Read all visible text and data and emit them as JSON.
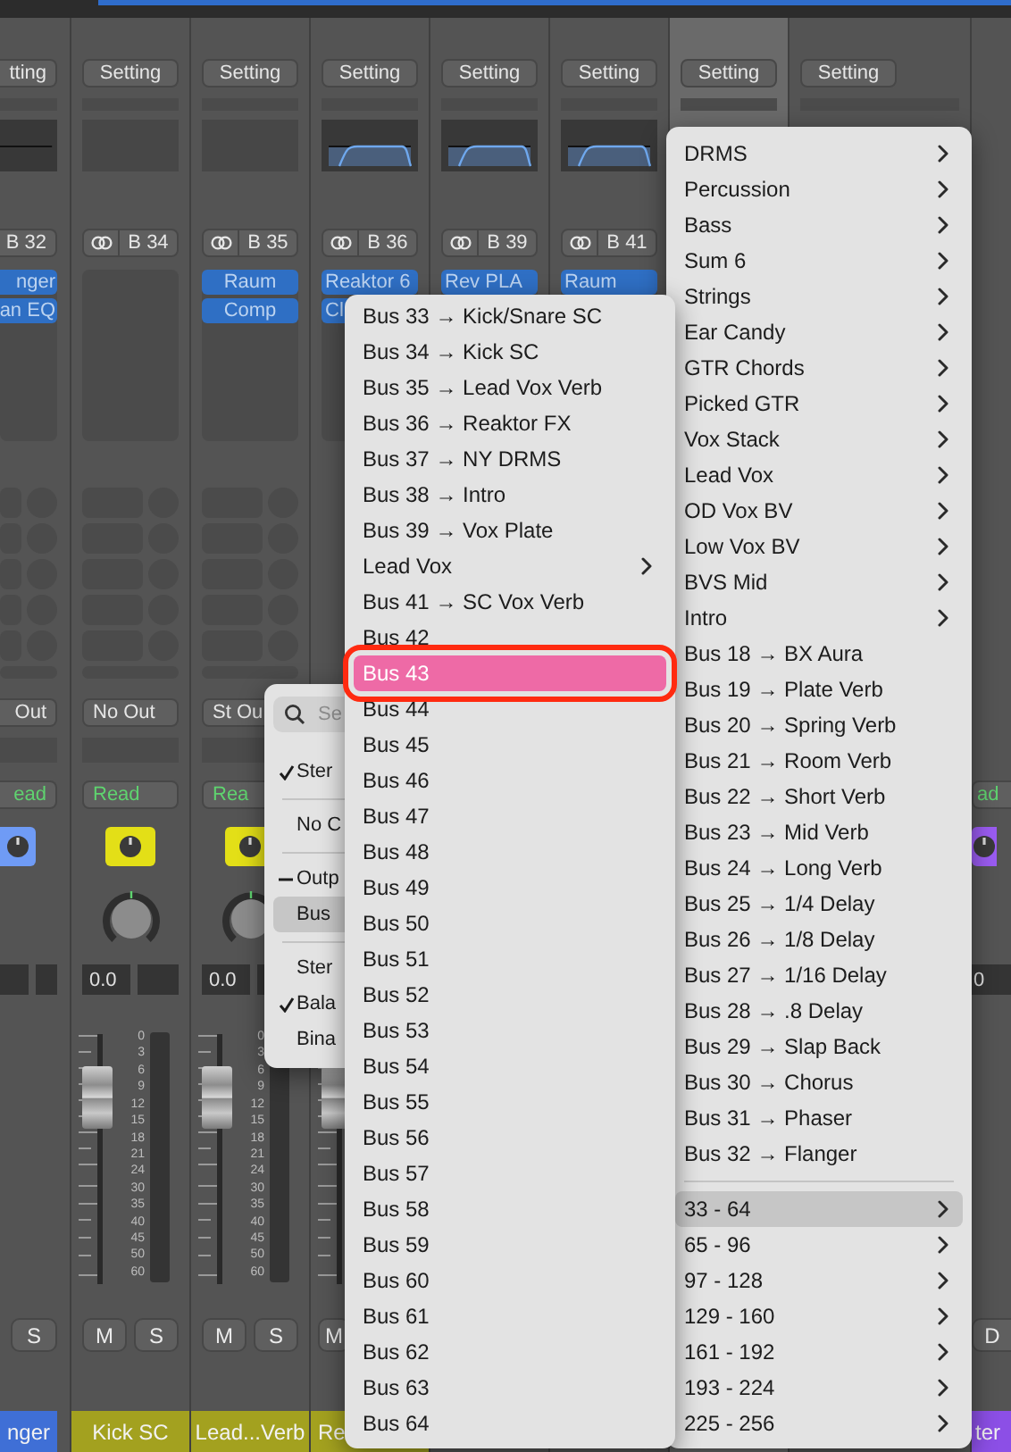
{
  "strips": [
    {
      "setting": "tting",
      "eq": {
        "kind": "flat"
      },
      "input": "B 32",
      "inserts": [
        "nger",
        "an EQ"
      ],
      "output": "Out",
      "automation": "ead",
      "group": {
        "color": "#6f9bf5"
      },
      "buttons": [
        "S"
      ],
      "name": {
        "text": "nger",
        "color": "#3f6fd6"
      },
      "selected": false
    },
    {
      "setting": "Setting",
      "eq": {
        "kind": "empty"
      },
      "input": "B 34",
      "output": "No Out",
      "automation": "Read",
      "group": {
        "color": "#e3df17"
      },
      "pan": "0.0",
      "level": 0.8,
      "scale": [
        "0",
        "3",
        "6",
        "9",
        "12",
        "15",
        "18",
        "21",
        "24",
        "30",
        "35",
        "40",
        "45",
        "50",
        "60"
      ],
      "buttons": [
        "M",
        "S"
      ],
      "name": {
        "text": "Kick SC",
        "color": "#a3a11f"
      },
      "selected": false
    },
    {
      "setting": "Setting",
      "eq": {
        "kind": "empty"
      },
      "input": "B 35",
      "inserts": [
        "Raum",
        "Comp"
      ],
      "output": "St Ou",
      "automation": "Rea",
      "group": {
        "color": "#e3df17"
      },
      "pan": "0.0",
      "level": 0.8,
      "scale": [
        "0",
        "3",
        "6",
        "9",
        "12",
        "15",
        "18",
        "21",
        "24",
        "30",
        "35",
        "40",
        "45",
        "50",
        "60"
      ],
      "buttons": [
        "M",
        "S"
      ],
      "name": {
        "text": "Lead...Verb",
        "color": "#a3a11f"
      },
      "selected": false
    },
    {
      "setting": "Setting",
      "eq": {
        "kind": "curve"
      },
      "input": "B 36",
      "inserts": [
        "Reaktor 6",
        "Cl"
      ],
      "level": 0.8,
      "buttons": [
        "M"
      ],
      "name": {
        "text": "Re",
        "color": "#a3a11f"
      },
      "selected": false
    },
    {
      "setting": "Setting",
      "eq": {
        "kind": "curve"
      },
      "input": "B 39",
      "inserts": [
        "Rev PLA"
      ],
      "selected": false
    },
    {
      "setting": "Setting",
      "eq": {
        "kind": "curve"
      },
      "input": "B 41",
      "inserts": [
        "Raum"
      ],
      "selected": false
    },
    {
      "setting": "Setting",
      "selected": true
    },
    {
      "setting": "Setting",
      "selected": false
    },
    {
      "automation": "ad",
      "group": {
        "color": "#9b5cf2"
      },
      "pan": "0",
      "buttons": [
        "D"
      ],
      "name": {
        "text": "ter",
        "color": "#8c4fe6"
      },
      "selected": false
    }
  ],
  "output_menu": {
    "search": {
      "placeholder": "Se"
    },
    "items": [
      {
        "kind": "item",
        "label": "Ster",
        "checked": true,
        "mixed": false,
        "selected": false
      },
      {
        "kind": "separator"
      },
      {
        "kind": "item",
        "label": "No C",
        "checked": false,
        "mixed": false,
        "selected": false
      },
      {
        "kind": "separator"
      },
      {
        "kind": "item",
        "label": "Outp",
        "checked": false,
        "mixed": true,
        "selected": false
      },
      {
        "kind": "item",
        "label": "Bus",
        "checked": false,
        "mixed": false,
        "selected": true
      },
      {
        "kind": "separator"
      },
      {
        "kind": "item",
        "label": "Ster",
        "checked": false,
        "mixed": false,
        "selected": false
      },
      {
        "kind": "item",
        "label": "Bala",
        "checked": true,
        "mixed": false,
        "selected": false
      },
      {
        "kind": "item",
        "label": "Bina",
        "checked": false,
        "mixed": false,
        "selected": false
      }
    ]
  },
  "bus_menu": {
    "items": [
      {
        "label": "Bus 33 → Kick/Snare SC",
        "submenu": false,
        "selected": false
      },
      {
        "label": "Bus 34 → Kick SC",
        "submenu": false,
        "selected": false
      },
      {
        "label": "Bus 35 → Lead Vox Verb",
        "submenu": false,
        "selected": false
      },
      {
        "label": "Bus 36 → Reaktor FX",
        "submenu": false,
        "selected": false
      },
      {
        "label": "Bus 37 → NY DRMS",
        "submenu": false,
        "selected": false
      },
      {
        "label": "Bus 38 → Intro",
        "submenu": false,
        "selected": false
      },
      {
        "label": "Bus 39 → Vox Plate",
        "submenu": false,
        "selected": false
      },
      {
        "label": "Lead Vox",
        "submenu": true,
        "selected": false
      },
      {
        "label": "Bus 41 → SC Vox Verb",
        "submenu": false,
        "selected": false
      },
      {
        "label": "Bus 42",
        "submenu": false,
        "selected": false
      },
      {
        "label": "Bus 43",
        "submenu": false,
        "selected": true
      },
      {
        "label": "Bus 44",
        "submenu": false,
        "selected": false
      },
      {
        "label": "Bus 45",
        "submenu": false,
        "selected": false
      },
      {
        "label": "Bus 46",
        "submenu": false,
        "selected": false
      },
      {
        "label": "Bus 47",
        "submenu": false,
        "selected": false
      },
      {
        "label": "Bus 48",
        "submenu": false,
        "selected": false
      },
      {
        "label": "Bus 49",
        "submenu": false,
        "selected": false
      },
      {
        "label": "Bus 50",
        "submenu": false,
        "selected": false
      },
      {
        "label": "Bus 51",
        "submenu": false,
        "selected": false
      },
      {
        "label": "Bus 52",
        "submenu": false,
        "selected": false
      },
      {
        "label": "Bus 53",
        "submenu": false,
        "selected": false
      },
      {
        "label": "Bus 54",
        "submenu": false,
        "selected": false
      },
      {
        "label": "Bus 55",
        "submenu": false,
        "selected": false
      },
      {
        "label": "Bus 56",
        "submenu": false,
        "selected": false
      },
      {
        "label": "Bus 57",
        "submenu": false,
        "selected": false
      },
      {
        "label": "Bus 58",
        "submenu": false,
        "selected": false
      },
      {
        "label": "Bus 59",
        "submenu": false,
        "selected": false
      },
      {
        "label": "Bus 60",
        "submenu": false,
        "selected": false
      },
      {
        "label": "Bus 61",
        "submenu": false,
        "selected": false
      },
      {
        "label": "Bus 62",
        "submenu": false,
        "selected": false
      },
      {
        "label": "Bus 63",
        "submenu": false,
        "selected": false
      },
      {
        "label": "Bus 64",
        "submenu": false,
        "selected": false
      }
    ]
  },
  "destination_menu": {
    "items": [
      {
        "kind": "item",
        "label": "DRMS",
        "submenu": true,
        "selected": false
      },
      {
        "kind": "item",
        "label": "Percussion",
        "submenu": true,
        "selected": false
      },
      {
        "kind": "item",
        "label": "Bass",
        "submenu": true,
        "selected": false
      },
      {
        "kind": "item",
        "label": "Sum 6",
        "submenu": true,
        "selected": false
      },
      {
        "kind": "item",
        "label": "Strings",
        "submenu": true,
        "selected": false
      },
      {
        "kind": "item",
        "label": "Ear Candy",
        "submenu": true,
        "selected": false
      },
      {
        "kind": "item",
        "label": "GTR Chords",
        "submenu": true,
        "selected": false
      },
      {
        "kind": "item",
        "label": "Picked GTR",
        "submenu": true,
        "selected": false
      },
      {
        "kind": "item",
        "label": "Vox Stack",
        "submenu": true,
        "selected": false
      },
      {
        "kind": "item",
        "label": "Lead Vox",
        "submenu": true,
        "selected": false
      },
      {
        "kind": "item",
        "label": "OD Vox BV",
        "submenu": true,
        "selected": false
      },
      {
        "kind": "item",
        "label": "Low Vox BV",
        "submenu": true,
        "selected": false
      },
      {
        "kind": "item",
        "label": "BVS Mid",
        "submenu": true,
        "selected": false
      },
      {
        "kind": "item",
        "label": "Intro",
        "submenu": true,
        "selected": false
      },
      {
        "kind": "item",
        "label": "Bus 18 → BX Aura",
        "submenu": false,
        "selected": false
      },
      {
        "kind": "item",
        "label": "Bus 19 → Plate Verb",
        "submenu": false,
        "selected": false
      },
      {
        "kind": "item",
        "label": "Bus 20 → Spring Verb",
        "submenu": false,
        "selected": false
      },
      {
        "kind": "item",
        "label": "Bus 21 → Room Verb",
        "submenu": false,
        "selected": false
      },
      {
        "kind": "item",
        "label": "Bus 22 → Short Verb",
        "submenu": false,
        "selected": false
      },
      {
        "kind": "item",
        "label": "Bus 23 → Mid Verb",
        "submenu": false,
        "selected": false
      },
      {
        "kind": "item",
        "label": "Bus 24 → Long Verb",
        "submenu": false,
        "selected": false
      },
      {
        "kind": "item",
        "label": "Bus 25 → 1/4 Delay",
        "submenu": false,
        "selected": false
      },
      {
        "kind": "item",
        "label": "Bus 26 → 1/8 Delay",
        "submenu": false,
        "selected": false
      },
      {
        "kind": "item",
        "label": "Bus 27 → 1/16 Delay",
        "submenu": false,
        "selected": false
      },
      {
        "kind": "item",
        "label": "Bus 28 → .8 Delay",
        "submenu": false,
        "selected": false
      },
      {
        "kind": "item",
        "label": "Bus 29 → Slap Back",
        "submenu": false,
        "selected": false
      },
      {
        "kind": "item",
        "label": "Bus 30 → Chorus",
        "submenu": false,
        "selected": false
      },
      {
        "kind": "item",
        "label": "Bus 31 → Phaser",
        "submenu": false,
        "selected": false
      },
      {
        "kind": "item",
        "label": "Bus 32 → Flanger",
        "submenu": false,
        "selected": false
      },
      {
        "kind": "separator"
      },
      {
        "kind": "item",
        "label": "33 - 64",
        "submenu": true,
        "selected": true
      },
      {
        "kind": "item",
        "label": "65 - 96",
        "submenu": true,
        "selected": false
      },
      {
        "kind": "item",
        "label": "97 - 128",
        "submenu": true,
        "selected": false
      },
      {
        "kind": "item",
        "label": "129 - 160",
        "submenu": true,
        "selected": false
      },
      {
        "kind": "item",
        "label": "161 - 192",
        "submenu": true,
        "selected": false
      },
      {
        "kind": "item",
        "label": "193 - 224",
        "submenu": true,
        "selected": false
      },
      {
        "kind": "item",
        "label": "225 - 256",
        "submenu": true,
        "selected": false
      }
    ]
  }
}
